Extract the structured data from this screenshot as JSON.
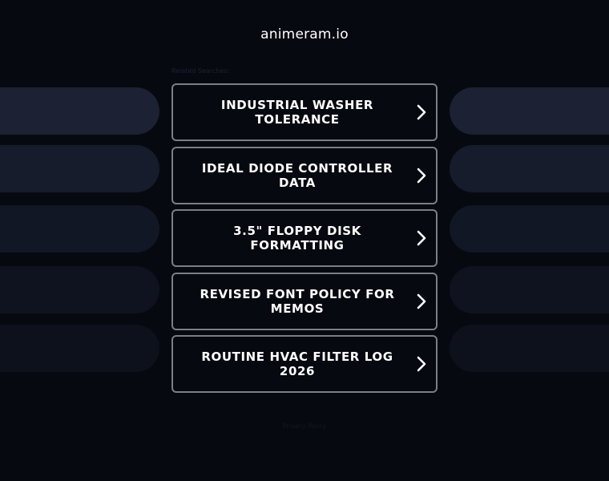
{
  "site": {
    "domain": "animeram.io"
  },
  "related_label": "Related Searches:",
  "links": [
    {
      "label": "INDUSTRIAL WASHER TOLERANCE"
    },
    {
      "label": "IDEAL DIODE CONTROLLER DATA"
    },
    {
      "label": "3.5\" FLOPPY DISK FORMATTING"
    },
    {
      "label": "REVISED FONT POLICY FOR MEMOS"
    },
    {
      "label": "ROUTINE HVAC FILTER LOG 2026"
    }
  ],
  "footer": {
    "privacy_label": "Privacy Policy"
  },
  "icons": {
    "link_chevron": "chevron-right-icon"
  },
  "colors": {
    "background": "#070910",
    "button_border": "#7a7e88",
    "text": "#ffffff",
    "side_pill": "#1c2233"
  }
}
